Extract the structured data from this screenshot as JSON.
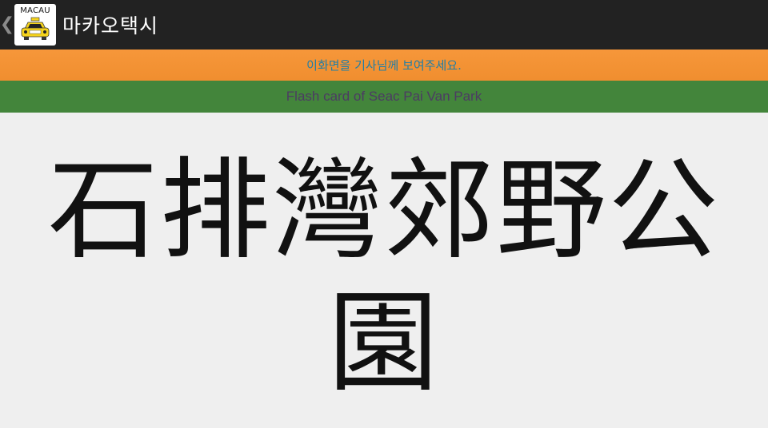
{
  "action_bar": {
    "up_icon": "chevron-left-icon",
    "app_icon": {
      "label": "MACAU",
      "icon": "taxi-icon",
      "accent": "#f5d31c"
    },
    "title": "마카오택시"
  },
  "notice": {
    "text": "이화면을 기사님께 보여주세요.",
    "background": "#f6973a",
    "text_color": "#1f7ea8"
  },
  "flash_card": {
    "subtitle": "Flash card of Seac Pai Van Park",
    "background": "#43853b",
    "text_color": "#4c3b63"
  },
  "content": {
    "place_name": "石排灣郊野公園"
  }
}
